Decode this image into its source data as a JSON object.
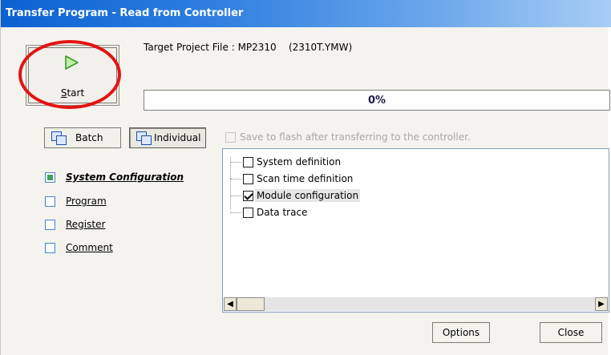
{
  "window": {
    "title": "Transfer Program - Read from Controller"
  },
  "start": {
    "label_underline": "S",
    "label_rest": "tart",
    "icon": "play-icon"
  },
  "target": {
    "text": "Target Project File : MP2310    (2310T.YMW)"
  },
  "progress": {
    "percent_text": "0%",
    "value": 0
  },
  "modes": {
    "batch_label": "Batch",
    "individual_label": "Individual",
    "selected": "Individual"
  },
  "flash": {
    "label": "Save to flash after transferring to the controller.",
    "checked": false,
    "enabled": false
  },
  "categories": [
    {
      "label": "System Configuration",
      "selected": true
    },
    {
      "label": "Program",
      "selected": false
    },
    {
      "label": "Register",
      "selected": false
    },
    {
      "label": "Comment",
      "selected": false
    }
  ],
  "tree": {
    "items": [
      {
        "label": "System definition",
        "checked": false
      },
      {
        "label": "Scan time definition",
        "checked": false
      },
      {
        "label": "Module configuration",
        "checked": true
      },
      {
        "label": "Data trace",
        "checked": false
      }
    ]
  },
  "buttons": {
    "options": "Options",
    "close": "Close"
  },
  "colors": {
    "title_start": "#0b61d1",
    "title_end": "#a9cdf5",
    "highlight_circle": "#e31414"
  }
}
